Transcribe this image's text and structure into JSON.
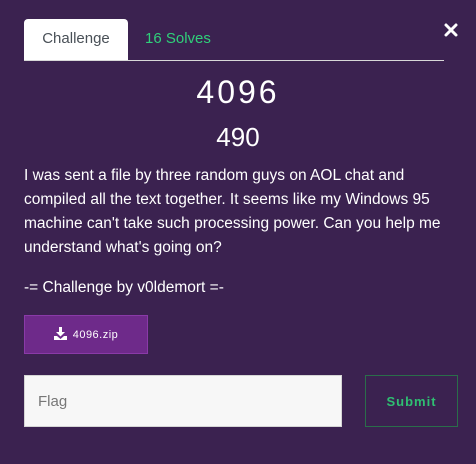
{
  "tabs": [
    {
      "label": "Challenge"
    },
    {
      "label": "16 Solves"
    }
  ],
  "challenge": {
    "name": "4096",
    "points": "490",
    "description": "I was sent a file by three random guys on AOL chat and compiled all the text together. It seems like my Windows 95 machine can't take such processing power. Can you help me understand what's going on?",
    "author": "-= Challenge by v0ldemort =-",
    "file": "4096.zip"
  },
  "form": {
    "flag_placeholder": "Flag",
    "submit_label": "Submit"
  },
  "colors": {
    "background": "#3b2250",
    "accent_green": "#2fd07a",
    "download_button": "#6e2a8a"
  }
}
